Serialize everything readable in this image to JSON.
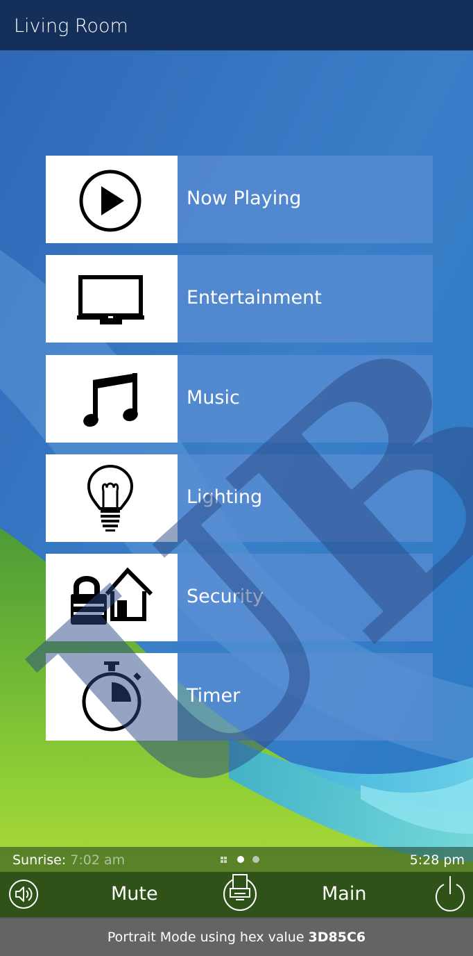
{
  "header": {
    "title": "Living Room"
  },
  "menu": {
    "items": [
      {
        "label": "Now Playing",
        "icon": "play-icon"
      },
      {
        "label": "Entertainment",
        "icon": "tv-icon"
      },
      {
        "label": "Music",
        "icon": "music-note-icon"
      },
      {
        "label": "Lighting",
        "icon": "light-bulb-icon"
      },
      {
        "label": "Security",
        "icon": "lock-house-icon"
      },
      {
        "label": "Timer",
        "icon": "stopwatch-icon"
      }
    ]
  },
  "status": {
    "sunrise_label": "Sunrise:",
    "sunrise_time": "7:02 am",
    "clock": "5:28 pm",
    "pages": {
      "count": 2,
      "active": 0
    }
  },
  "controls": {
    "mute_label": "Mute",
    "main_label": "Main",
    "volume_icon": "volume-icon",
    "menu_icon": "menu-icon",
    "power_icon": "power-icon"
  },
  "footer": {
    "caption": "Portrait Mode using hex value",
    "hex": "3D85C6"
  },
  "watermark": {
    "text": "UB"
  },
  "colors": {
    "background": "#3D85C6",
    "header": "#14305A",
    "tile_label_bg": "#5C8ED2",
    "control_bar": "#2F5219",
    "footer": "#646464"
  }
}
